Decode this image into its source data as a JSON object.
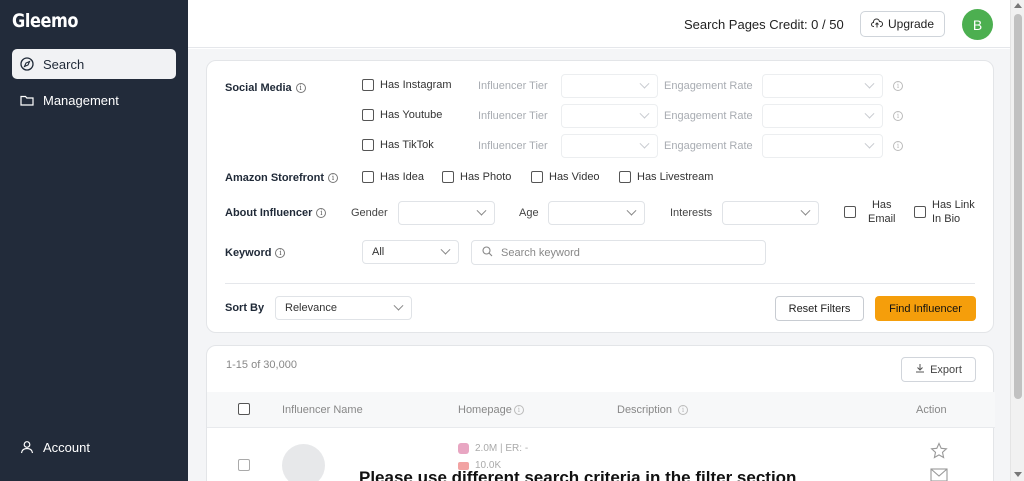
{
  "app": {
    "name": "Gleemo"
  },
  "sidebar": {
    "items": [
      {
        "label": "Search",
        "icon": "compass-icon",
        "active": true
      },
      {
        "label": "Management",
        "icon": "folder-icon",
        "active": false
      }
    ],
    "account": {
      "label": "Account",
      "icon": "user-icon"
    }
  },
  "header": {
    "credit_text": "Search Pages Credit: 0 / 50",
    "upgrade_label": "Upgrade",
    "avatar_initial": "B",
    "avatar_color": "#4caf50"
  },
  "filters": {
    "social_media_label": "Social Media",
    "platforms": [
      {
        "label": "Has Instagram",
        "tier_label": "Influencer Tier",
        "engagement_label": "Engagement Rate"
      },
      {
        "label": "Has Youtube",
        "tier_label": "Influencer Tier",
        "engagement_label": "Engagement Rate"
      },
      {
        "label": "Has TikTok",
        "tier_label": "Influencer Tier",
        "engagement_label": "Engagement Rate"
      }
    ],
    "amazon_label": "Amazon Storefront",
    "amazon_options": [
      "Has Idea",
      "Has Photo",
      "Has Video",
      "Has Livestream"
    ],
    "about_label": "About Influencer",
    "gender_label": "Gender",
    "age_label": "Age",
    "interests_label": "Interests",
    "has_email_label": [
      "Has",
      "Email"
    ],
    "has_link_label": [
      "Has Link",
      "In Bio"
    ],
    "keyword_label": "Keyword",
    "keyword_scope": "All",
    "keyword_placeholder": "Search keyword",
    "sort_by_label": "Sort By",
    "sort_by_value": "Relevance",
    "reset_label": "Reset Filters",
    "find_label": "Find Influencer",
    "accent_color": "#f59e0b"
  },
  "results": {
    "count_text": "1-15 of 30,000",
    "export_label": "Export",
    "columns": [
      "Influencer Name",
      "Homepage",
      "Description",
      "Action"
    ],
    "row": {
      "instagram_stat": "2.0M | ER: -",
      "youtube_stat": "10.0K"
    },
    "empty_message": "Please use different search criteria in the filter section"
  }
}
